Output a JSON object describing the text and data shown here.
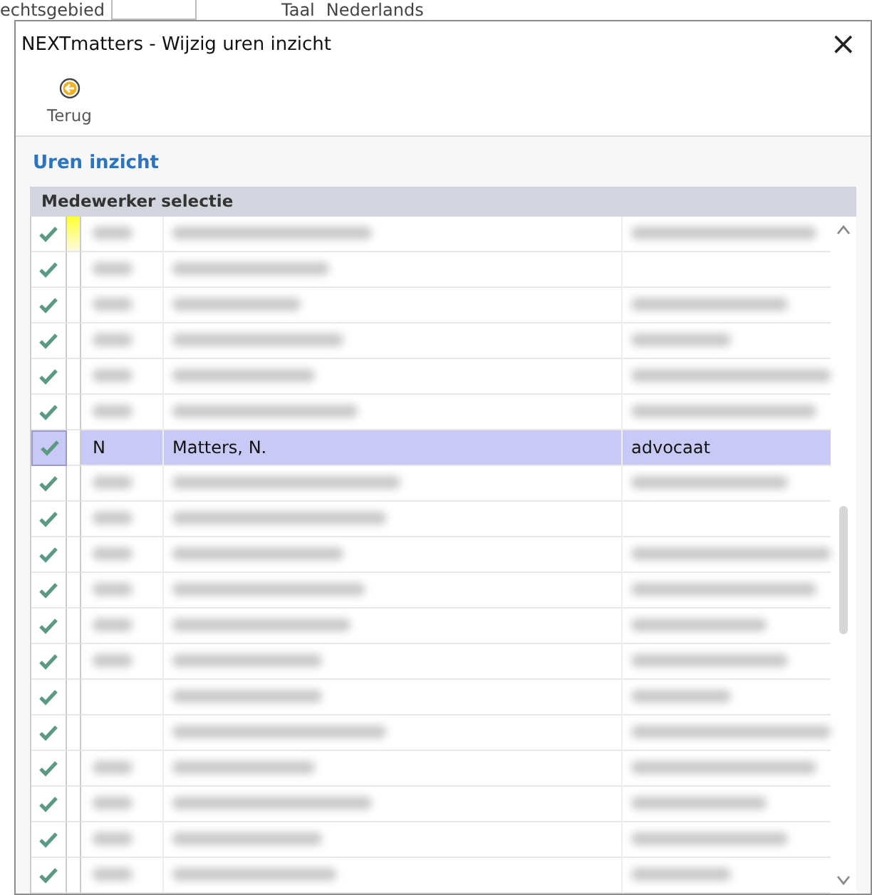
{
  "background": {
    "labels": [
      "echtsgebied",
      "Taal",
      "Nederlands"
    ]
  },
  "window": {
    "title": "NEXTmatters - Wijzig uren inzicht",
    "close": "×"
  },
  "toolbar": [
    {
      "label": "Terug"
    }
  ],
  "section_title": "Uren inzicht",
  "grid": {
    "header": "Medewerker selectie",
    "rows": [
      {
        "checked": true,
        "selected": false,
        "marked": true,
        "kind": "blurred",
        "code": true,
        "name": true,
        "job": true
      },
      {
        "checked": true,
        "selected": false,
        "marked": false,
        "kind": "blurred",
        "code": true,
        "name": true,
        "job": false
      },
      {
        "checked": true,
        "selected": false,
        "marked": false,
        "kind": "blurred",
        "code": true,
        "name": true,
        "job": true
      },
      {
        "checked": true,
        "selected": false,
        "marked": false,
        "kind": "blurred",
        "code": true,
        "name": true,
        "job": true
      },
      {
        "checked": true,
        "selected": false,
        "marked": false,
        "kind": "blurred",
        "code": true,
        "name": true,
        "job": true
      },
      {
        "checked": true,
        "selected": false,
        "marked": false,
        "kind": "blurred",
        "code": true,
        "name": true,
        "job": true
      },
      {
        "checked": true,
        "selected": true,
        "marked": false,
        "kind": "text",
        "code": "N",
        "name": "Matters, N.",
        "job": "advocaat"
      },
      {
        "checked": true,
        "selected": false,
        "marked": false,
        "kind": "blurred",
        "code": true,
        "name": true,
        "job": true
      },
      {
        "checked": true,
        "selected": false,
        "marked": false,
        "kind": "blurred",
        "code": true,
        "name": true,
        "job": false
      },
      {
        "checked": true,
        "selected": false,
        "marked": false,
        "kind": "blurred",
        "code": true,
        "name": true,
        "job": true
      },
      {
        "checked": true,
        "selected": false,
        "marked": false,
        "kind": "blurred",
        "code": true,
        "name": true,
        "job": true
      },
      {
        "checked": true,
        "selected": false,
        "marked": false,
        "kind": "blurred",
        "code": true,
        "name": true,
        "job": true
      },
      {
        "checked": true,
        "selected": false,
        "marked": false,
        "kind": "blurred",
        "code": true,
        "name": true,
        "job": true
      },
      {
        "checked": true,
        "selected": false,
        "marked": false,
        "kind": "blurred",
        "code": false,
        "name": true,
        "job": true
      },
      {
        "checked": true,
        "selected": false,
        "marked": false,
        "kind": "blurred",
        "code": false,
        "name": true,
        "job": true
      },
      {
        "checked": true,
        "selected": false,
        "marked": false,
        "kind": "blurred",
        "code": true,
        "name": true,
        "job": true
      },
      {
        "checked": true,
        "selected": false,
        "marked": false,
        "kind": "blurred",
        "code": true,
        "name": true,
        "job": true
      },
      {
        "checked": true,
        "selected": false,
        "marked": false,
        "kind": "blurred",
        "code": true,
        "name": true,
        "job": true
      },
      {
        "checked": true,
        "selected": false,
        "marked": false,
        "kind": "blurred",
        "code": true,
        "name": true,
        "job": true
      }
    ]
  }
}
